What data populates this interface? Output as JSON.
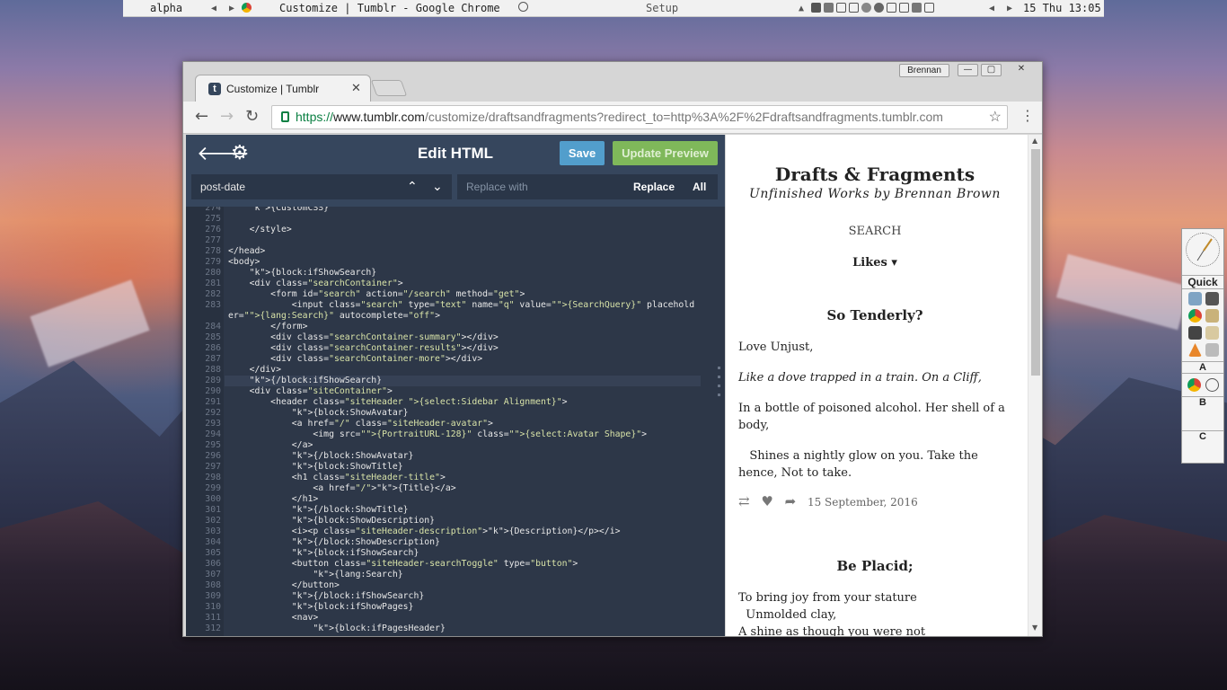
{
  "panel": {
    "workspace": "alpha",
    "window_title": "Customize | Tumblr - Google Chrome",
    "setup": "Setup",
    "clock": "15 Thu 13:05",
    "nav_left": "◀",
    "nav_right": "▶"
  },
  "window": {
    "user": "Brennan",
    "minimize": "—",
    "maximize": "▢",
    "close": "✕",
    "tab_title": "Customize | Tumblr",
    "tab_close": "✕",
    "url_scheme": "https://",
    "url_host": "www.tumblr.com",
    "url_rest": "/customize/draftsandfragments?redirect_to=http%3A%2F%2Fdraftsandfragments.tumblr.com"
  },
  "editor": {
    "title": "Edit HTML",
    "save": "Save",
    "update_preview": "Update Preview",
    "search_value": "post-date",
    "replace_placeholder": "Replace with",
    "replace": "Replace",
    "all": "All"
  },
  "code": {
    "line_numbers": [
      "274",
      "275",
      "276",
      "277",
      "278",
      "279",
      "280",
      "281",
      "282",
      "283",
      "",
      "284",
      "285",
      "286",
      "287",
      "288",
      "289",
      "290",
      "291",
      "292",
      "293",
      "294",
      "295",
      "296",
      "297",
      "298",
      "299",
      "300",
      "301",
      "302",
      "303",
      "304",
      "305",
      "306",
      "307",
      "308",
      "309",
      "310",
      "311",
      "312"
    ],
    "lines": [
      "    {CustomCSS}",
      "",
      "    </style>",
      "",
      "</head>",
      "<body>",
      "    {block:ifShowSearch}",
      "    <div class=\"searchContainer\">",
      "        <form id=\"search\" action=\"/search\" method=\"get\">",
      "            <input class=\"search\" type=\"text\" name=\"q\" value=\"{SearchQuery}\" placehold",
      "er=\"{lang:Search}\" autocomplete=\"off\">",
      "        </form>",
      "        <div class=\"searchContainer-summary\"></div>",
      "        <div class=\"searchContainer-results\"></div>",
      "        <div class=\"searchContainer-more\"></div>",
      "    </div>",
      "    {/block:ifShowSearch}",
      "    <div class=\"siteContainer\">",
      "        <header class=\"siteHeader {select:Sidebar Alignment}\">",
      "            {block:ShowAvatar}",
      "            <a href=\"/\" class=\"siteHeader-avatar\">",
      "                <img src=\"{PortraitURL-128}\" class=\"{select:Avatar Shape}\">",
      "            </a>",
      "            {/block:ShowAvatar}",
      "            {block:ShowTitle}",
      "            <h1 class=\"siteHeader-title\">",
      "                <a href=\"/\">{Title}</a>",
      "            </h1>",
      "            {/block:ShowTitle}",
      "            {block:ShowDescription}",
      "            <i><p class=\"siteHeader-description\">{Description}</p></i>",
      "            {/block:ShowDescription}",
      "            {block:ifShowSearch}",
      "            <button class=\"siteHeader-searchToggle\" type=\"button\">",
      "                {lang:Search}",
      "            </button>",
      "            {/block:ifShowSearch}",
      "            {block:ifShowPages}",
      "            <nav>",
      "                {block:ifPagesHeader}"
    ]
  },
  "preview": {
    "blog_title": "Drafts & Fragments",
    "subtitle": "Unfinished Works by Brennan Brown",
    "search": "SEARCH",
    "likes": "Likes ▾",
    "post1_title": "So Tenderly?",
    "post1_p1": "Love Unjust,",
    "post1_p2": "Like a dove trapped in a train. On a Cliff,",
    "post1_p3": "In a bottle of poisoned alcohol. Her shell of a body,",
    "post1_p4": "   Shines a nightly glow on you. Take the hence, Not to take.",
    "post1_date": "15 September, 2016",
    "post2_title": "Be Placid;",
    "post2_l1": "To bring joy from your stature",
    "post2_l2": "  Unmolded clay,",
    "post2_l3": "A shine as though you were not"
  },
  "dock": {
    "quick": "Quick",
    "a": "A",
    "b": "B",
    "c": "C"
  }
}
